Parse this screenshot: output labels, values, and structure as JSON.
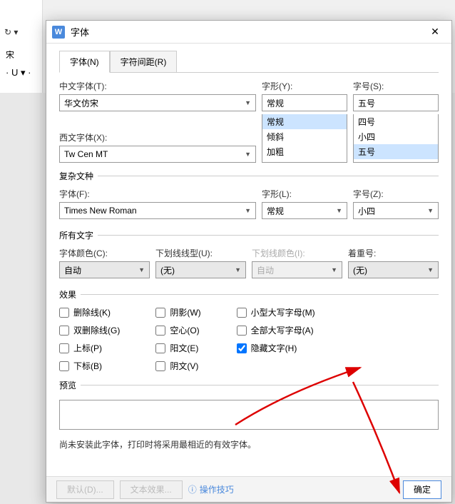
{
  "bg": {
    "redo": "↻ ▾",
    "font": "宋",
    "underline": "· U ▾ ·"
  },
  "dialog": {
    "title": "字体",
    "tabs": {
      "font": "字体(N)",
      "spacing": "字符间距(R)"
    },
    "chinese_font": {
      "label": "中文字体(T):",
      "value": "华文仿宋"
    },
    "style": {
      "label": "字形(Y):",
      "value": "常规",
      "options": [
        "常规",
        "倾斜",
        "加粗"
      ]
    },
    "size": {
      "label": "字号(S):",
      "value": "五号",
      "options": [
        "四号",
        "小四",
        "五号"
      ]
    },
    "western_font": {
      "label": "西文字体(X):",
      "value": "Tw Cen MT"
    },
    "complex": {
      "legend": "复杂文种",
      "font": {
        "label": "字体(F):",
        "value": "Times New Roman"
      },
      "style": {
        "label": "字形(L):",
        "value": "常规"
      },
      "size": {
        "label": "字号(Z):",
        "value": "小四"
      }
    },
    "alltext": {
      "legend": "所有文字",
      "color": {
        "label": "字体颜色(C):",
        "value": "自动"
      },
      "underline_style": {
        "label": "下划线线型(U):",
        "value": "(无)"
      },
      "underline_color": {
        "label": "下划线颜色(I):",
        "value": "自动"
      },
      "emphasis": {
        "label": "着重号:",
        "value": "(无)"
      }
    },
    "effects": {
      "legend": "效果",
      "strikethrough": "删除线(K)",
      "double_strike": "双删除线(G)",
      "superscript": "上标(P)",
      "subscript": "下标(B)",
      "shadow": "阴影(W)",
      "hollow": "空心(O)",
      "engrave": "阳文(E)",
      "emboss": "阴文(V)",
      "small_caps": "小型大写字母(M)",
      "all_caps": "全部大写字母(A)",
      "hidden": "隐藏文字(H)"
    },
    "preview": {
      "legend": "预览"
    },
    "note": "尚未安装此字体，打印时将采用最相近的有效字体。",
    "footer": {
      "default_btn": "默认(D)...",
      "text_effects": "文本效果...",
      "tips": "操作技巧",
      "ok": "确定"
    }
  }
}
